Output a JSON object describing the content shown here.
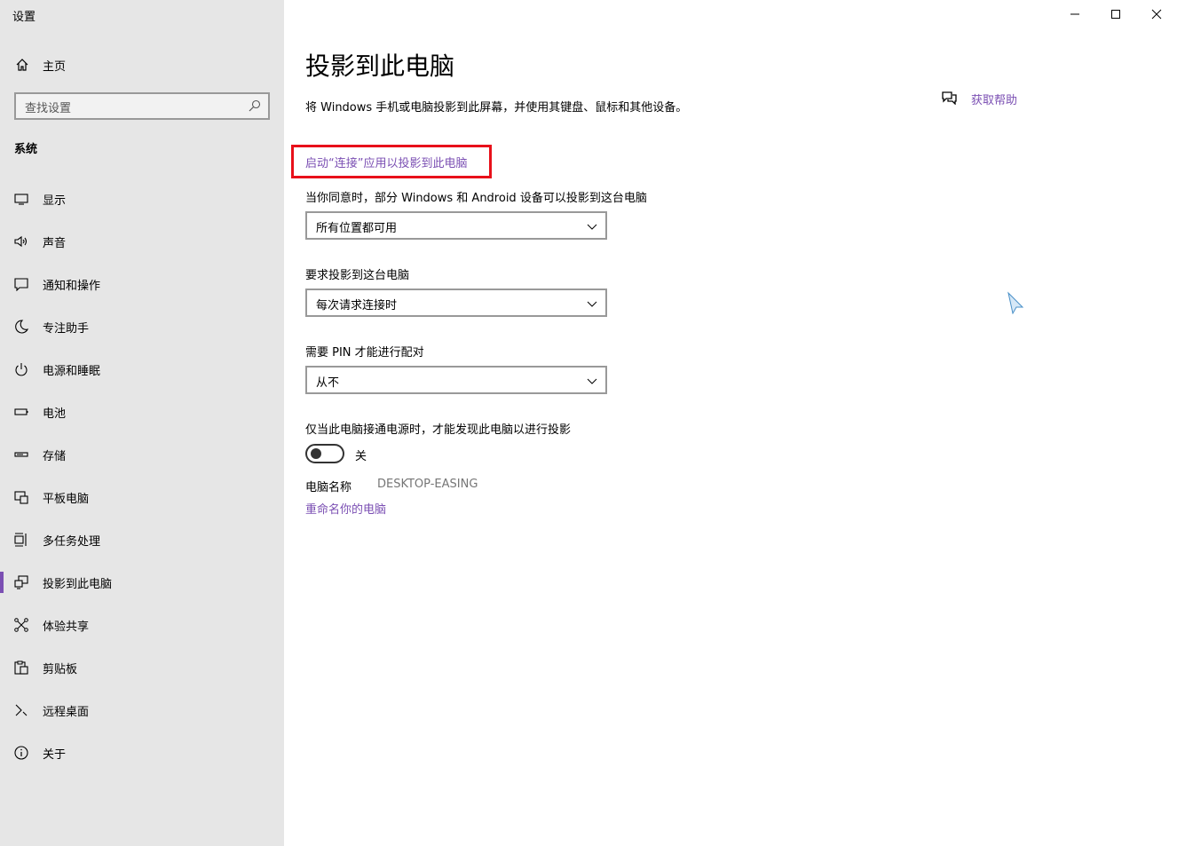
{
  "window": {
    "title": "设置",
    "controls": [
      "minimize",
      "maximize",
      "close"
    ]
  },
  "sidebar": {
    "home_label": "主页",
    "search_placeholder": "查找设置",
    "section_label": "系统",
    "items": [
      {
        "label": "显示",
        "icon": "monitor-icon"
      },
      {
        "label": "声音",
        "icon": "speaker-icon"
      },
      {
        "label": "通知和操作",
        "icon": "notification-icon"
      },
      {
        "label": "专注助手",
        "icon": "moon-icon"
      },
      {
        "label": "电源和睡眠",
        "icon": "power-icon"
      },
      {
        "label": "电池",
        "icon": "battery-icon"
      },
      {
        "label": "存储",
        "icon": "storage-icon"
      },
      {
        "label": "平板电脑",
        "icon": "tablet-icon"
      },
      {
        "label": "多任务处理",
        "icon": "multitask-icon"
      },
      {
        "label": "投影到此电脑",
        "icon": "project-icon",
        "active": true
      },
      {
        "label": "体验共享",
        "icon": "share-icon"
      },
      {
        "label": "剪贴板",
        "icon": "clipboard-icon"
      },
      {
        "label": "远程桌面",
        "icon": "remote-icon"
      },
      {
        "label": "关于",
        "icon": "info-icon"
      }
    ]
  },
  "main": {
    "title": "投影到此电脑",
    "description": "将 Windows 手机或电脑投影到此屏幕，并使用其键盘、鼠标和其他设备。",
    "launch_link": "启动“连接”应用以投影到此电脑",
    "availability_label": "当你同意时，部分 Windows 和 Android 设备可以投影到这台电脑",
    "availability_value": "所有位置都可用",
    "request_label": "要求投影到这台电脑",
    "request_value": "每次请求连接时",
    "pin_label": "需要 PIN 才能进行配对",
    "pin_value": "从不",
    "power_label": "仅当此电脑接通电源时，才能发现此电脑以进行投影",
    "power_toggle_state": "关",
    "pc_name_label": "电脑名称",
    "pc_name_value": "DESKTOP-EASING",
    "rename_link": "重命名你的电脑",
    "help_label": "获取帮助"
  },
  "colors": {
    "accent": "#7b4fb3",
    "highlight": "#e8101a",
    "sidebar_bg": "#e6e6e6"
  }
}
